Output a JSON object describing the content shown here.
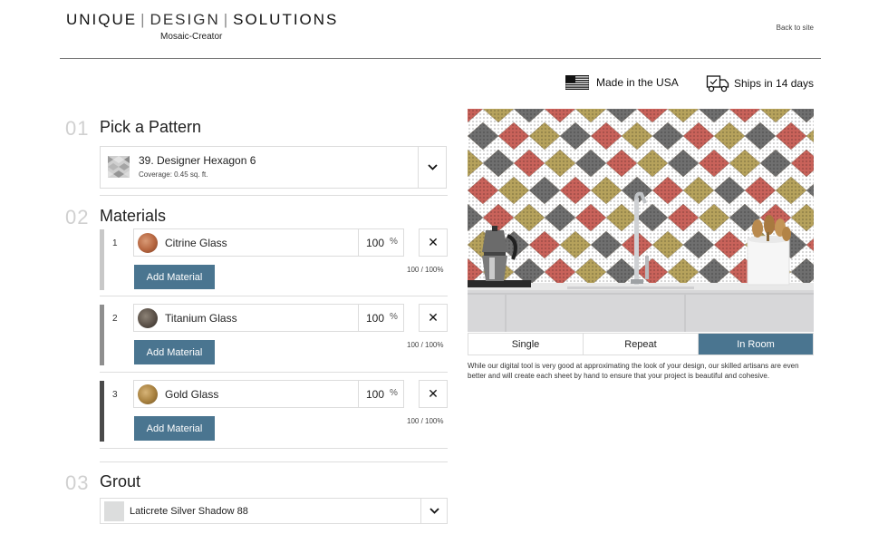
{
  "header": {
    "brand_word1": "UNIQUE",
    "brand_word2": "DESIGN",
    "brand_word3": "SOLUTIONS",
    "subtitle": "Mosaic-Creator",
    "back_link": "Back to site",
    "made_in": "Made in the USA",
    "ships": "Ships in 14 days"
  },
  "steps": {
    "pattern": {
      "number": "01",
      "title": "Pick a Pattern"
    },
    "materials": {
      "number": "02",
      "title": "Materials"
    },
    "grout": {
      "number": "03",
      "title": "Grout"
    }
  },
  "pattern": {
    "name": "39. Designer Hexagon 6",
    "coverage": "Coverage: 0.45 sq. ft."
  },
  "materials": [
    {
      "index": "1",
      "name": "Citrine Glass",
      "percent": "100",
      "pct_sign": "%",
      "add_label": "Add Material",
      "ratio": "100 / 100%",
      "bar_color": "#c8c8c8",
      "swatch_color": "#b5653f"
    },
    {
      "index": "2",
      "name": "Titanium Glass",
      "percent": "100",
      "pct_sign": "%",
      "add_label": "Add Material",
      "ratio": "100 / 100%",
      "bar_color": "#8f8f8f",
      "swatch_color": "#5b5148"
    },
    {
      "index": "3",
      "name": "Gold Glass",
      "percent": "100",
      "pct_sign": "%",
      "add_label": "Add Material",
      "ratio": "100 / 100%",
      "bar_color": "#4a4a4a",
      "swatch_color": "#a7803e"
    }
  ],
  "grout": {
    "name": "Laticrete Silver Shadow 88",
    "swatch_color": "#dcdddd"
  },
  "preview": {
    "tabs": [
      "Single",
      "Repeat",
      "In Room"
    ],
    "active_tab": "In Room",
    "disclaimer": "While our digital tool is very good at approximating the look of your design, our skilled artisans are even better and will create each sheet by hand to ensure that your project is beautiful and cohesive."
  },
  "colors": {
    "accent": "#4a7590",
    "border": "#dcdcdc",
    "step_number": "#d0d0d0",
    "tile_red": "#c9625a",
    "tile_gold": "#b6a25c",
    "tile_gray": "#6f6f6f"
  },
  "icons": {
    "flag": "us-flag-icon",
    "truck": "delivery-truck-icon",
    "dropdown": "chevron-down-icon",
    "remove": "close-icon"
  }
}
